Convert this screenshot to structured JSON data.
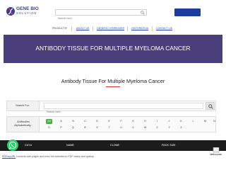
{
  "header": {
    "logo_line1": "GENE BIO",
    "logo_line2": "SOLUTION",
    "search_placeholder": "Search here...",
    "brand_color": "#3a3f8f",
    "cta_color": "#1a3d9e"
  },
  "nav": {
    "items": [
      {
        "label": "PRODUCTS"
      },
      {
        "label": "ABOUT US"
      },
      {
        "label": "GENERIC HYBRIDIZER"
      },
      {
        "label": "HISTOPATH AI"
      },
      {
        "label": "CONTACT US"
      }
    ]
  },
  "banner": {
    "title": "ANTIBODY TISSUE FOR MULTIPLE MYELOMA CANCER",
    "color": "#4a3f7a"
  },
  "section": {
    "title": "Antibody Tissue For Multiple Myeloma Cancer"
  },
  "search": {
    "label": "Search For..",
    "placeholder": "Search here..."
  },
  "alphabet": {
    "label_line1": "Antibodies",
    "label_line2": "Alphabetically :",
    "active": "All",
    "letters": [
      "All",
      "A",
      "B",
      "C",
      "D",
      "E",
      "F",
      "G",
      "H",
      "I",
      "J",
      "K",
      "L",
      "M",
      "N",
      "O",
      "P",
      "Q",
      "R",
      "S",
      "T",
      "U",
      "V",
      "W",
      "X",
      "Y",
      "Z"
    ]
  },
  "table": {
    "columns": [
      "CAT.#",
      "NAME",
      "CLONE",
      "PACK SIZE"
    ]
  },
  "footer": {
    "link_text": "PDFmyURL",
    "text": " converts web pages and even full websites to PDF easily and quickly.",
    "badge_text": "PDFmyURL"
  }
}
